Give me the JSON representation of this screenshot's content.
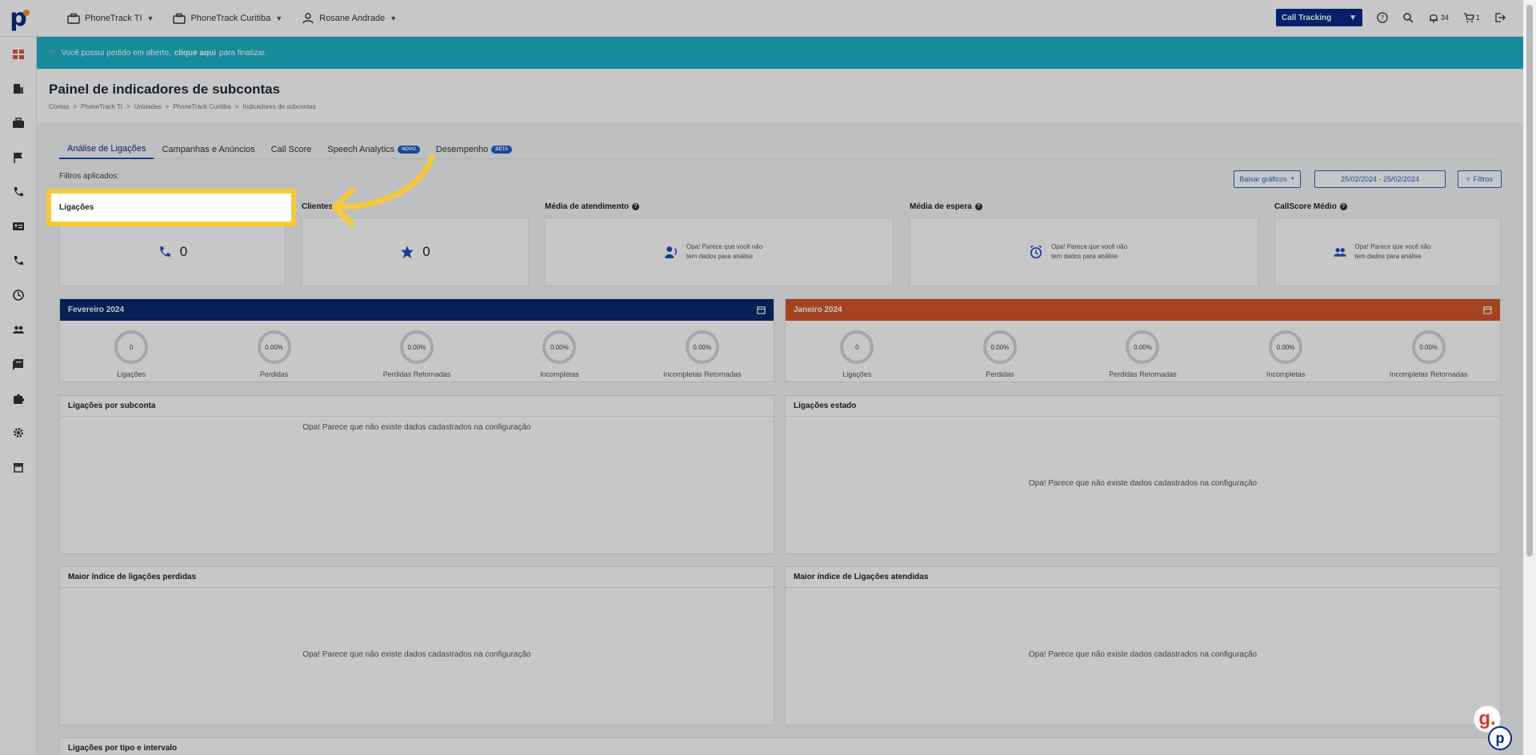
{
  "topbar": {
    "account": "PhoneTrack TI",
    "unit": "PhoneTrack Curitiba",
    "user": "Rosane Andrade",
    "product_select": "Call Tracking",
    "notifications_count": "34",
    "cart_count": "1"
  },
  "banner": {
    "text_before": "Você possui pedido em aberto,",
    "link": "clique aqui",
    "text_after": "para finalizar."
  },
  "header": {
    "title": "Painel de indicadores de subcontas",
    "breadcrumb": [
      "Contas",
      "PhoneTrack TI",
      "Unidades",
      "PhoneTrack Curitiba",
      "Indicadores de subcontas"
    ]
  },
  "tabs": [
    {
      "label": "Análise de Ligações"
    },
    {
      "label": "Campanhas e Anúncios"
    },
    {
      "label": "Call Score"
    },
    {
      "label": "Speech Analytics",
      "badge": "NOVO"
    },
    {
      "label": "Desempenho",
      "badge": "BETA"
    }
  ],
  "filters": {
    "label": "Filtros aplicados:",
    "download_label": "Baixar gráficos",
    "date_range": "25/02/2024 - 25/02/2024",
    "filters_button": "Filtros"
  },
  "kpis": {
    "ligacoes": {
      "title": "Ligações",
      "value": "0"
    },
    "clientes": {
      "title": "Clientes",
      "value": "0"
    },
    "media_atendimento": {
      "title": "Média de atendimento",
      "empty": "Opa! Parece que você não tem dados para análise"
    },
    "media_espera": {
      "title": "Média de espera",
      "empty": "Opa! Parece que você não tem dados para análise"
    },
    "callscore": {
      "title": "CallScore Médio",
      "empty": "Opa! Parece que você não tem dados para análise"
    }
  },
  "months": {
    "feb": {
      "title": "Fevereiro 2024",
      "color": "#0a2a6e",
      "stats": [
        {
          "value": "0",
          "label": "Ligações"
        },
        {
          "value": "0.00%",
          "label": "Perdidas"
        },
        {
          "value": "0.00%",
          "label": "Perdidas Retornadas"
        },
        {
          "value": "0.00%",
          "label": "Incompletas"
        },
        {
          "value": "0.00%",
          "label": "Incompletas Retornadas"
        }
      ]
    },
    "jan": {
      "title": "Janeiro 2024",
      "color": "#d4562a",
      "stats": [
        {
          "value": "0",
          "label": "Ligações"
        },
        {
          "value": "0.00%",
          "label": "Perdidas"
        },
        {
          "value": "0.00%",
          "label": "Perdidas Retornadas"
        },
        {
          "value": "0.00%",
          "label": "Incompletas"
        },
        {
          "value": "0.00%",
          "label": "Incompletas Retornadas"
        }
      ]
    }
  },
  "boxes": {
    "por_subconta": {
      "title": "Ligações por subconta",
      "empty": "Opa! Parece que não existe dados cadastrados na configuração"
    },
    "estado": {
      "title": "Ligações estado",
      "empty": "Opa! Parece que não existe dados cadastrados na configuração"
    },
    "perdidas": {
      "title": "Maior índice de ligações perdidas",
      "empty": "Opa! Parece que não existe dados cadastrados na configuração"
    },
    "atendidas": {
      "title": "Maior índice de Ligações atendidas",
      "empty": "Opa! Parece que não existe dados cadastrados na configuração"
    },
    "tipo_intervalo": {
      "title": "Ligações por tipo e intervalo"
    }
  },
  "widgets": {
    "g_label": "g.",
    "p_label": "p"
  }
}
